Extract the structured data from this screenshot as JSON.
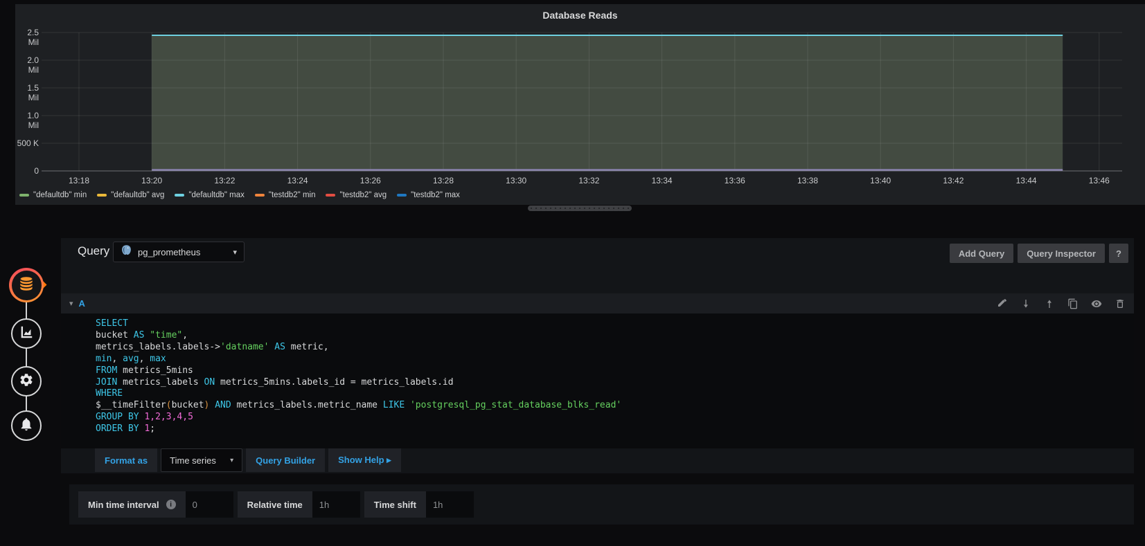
{
  "chart_panel": {
    "title": "Database Reads",
    "chart_data": {
      "type": "area",
      "title": "Database Reads",
      "x_ticks": [
        "13:18",
        "13:20",
        "13:22",
        "13:24",
        "13:26",
        "13:28",
        "13:30",
        "13:32",
        "13:34",
        "13:36",
        "13:38",
        "13:40",
        "13:42",
        "13:44",
        "13:46"
      ],
      "y_ticks": [
        "0",
        "500 K",
        "1.0 Mil",
        "1.5 Mil",
        "2.0 Mil",
        "2.5 Mil"
      ],
      "ylim": [
        0,
        2500000
      ],
      "grid": true,
      "legend_position": "bottom",
      "series": [
        {
          "name": "\"defaultdb\" min",
          "color": "#7EB26D",
          "value": 0
        },
        {
          "name": "\"defaultdb\" avg",
          "color": "#EAB839",
          "value": 0
        },
        {
          "name": "\"defaultdb\" max",
          "color": "#6ED0E0",
          "value": 2450000
        },
        {
          "name": "\"testdb2\" min",
          "color": "#EF843C",
          "value": 0
        },
        {
          "name": "\"testdb2\" avg",
          "color": "#E24D42",
          "value": 0
        },
        {
          "name": "\"testdb2\" max",
          "color": "#1F78C1",
          "value": 0
        }
      ],
      "data_window": {
        "start": "13:20",
        "end": "13:45"
      },
      "fill_color": "#434b41",
      "top_line_color": "#6ED0E0",
      "bottom_line_color": "#8a82ae"
    }
  },
  "query_header": {
    "title": "Query",
    "datasource": "pg_prometheus",
    "add_query_label": "Add Query",
    "query_inspector_label": "Query Inspector",
    "help_label": "?"
  },
  "query_row": {
    "ref_id": "A"
  },
  "sql_lines": [
    [
      {
        "c": "kw",
        "v": "SELECT"
      }
    ],
    [
      {
        "c": "pl",
        "v": "  bucket "
      },
      {
        "c": "kw",
        "v": "AS"
      },
      {
        "c": "pl",
        "v": " "
      },
      {
        "c": "str",
        "v": "\"time\""
      },
      {
        "c": "pl",
        "v": ","
      }
    ],
    [
      {
        "c": "pl",
        "v": "  metrics_labels.labels->"
      },
      {
        "c": "str",
        "v": "'datname'"
      },
      {
        "c": "pl",
        "v": " "
      },
      {
        "c": "kw",
        "v": "AS"
      },
      {
        "c": "pl",
        "v": " metric,"
      }
    ],
    [
      {
        "c": "pl",
        "v": "  "
      },
      {
        "c": "kw",
        "v": "min"
      },
      {
        "c": "pl",
        "v": ", "
      },
      {
        "c": "kw",
        "v": "avg"
      },
      {
        "c": "pl",
        "v": ", "
      },
      {
        "c": "kw",
        "v": "max"
      }
    ],
    [
      {
        "c": "kw",
        "v": "FROM"
      },
      {
        "c": "pl",
        "v": " metrics_5mins"
      }
    ],
    [
      {
        "c": "kw",
        "v": "JOIN"
      },
      {
        "c": "pl",
        "v": " metrics_labels "
      },
      {
        "c": "kw",
        "v": "ON"
      },
      {
        "c": "pl",
        "v": " metrics_5mins.labels_id = metrics_labels.id"
      }
    ],
    [
      {
        "c": "kw",
        "v": "WHERE"
      }
    ],
    [
      {
        "c": "pl",
        "v": "  $__timeFilter"
      },
      {
        "c": "par",
        "v": "("
      },
      {
        "c": "pl",
        "v": "bucket"
      },
      {
        "c": "par",
        "v": ")"
      },
      {
        "c": "pl",
        "v": " "
      },
      {
        "c": "kw",
        "v": "AND"
      },
      {
        "c": "pl",
        "v": " metrics_labels.metric_name "
      },
      {
        "c": "kw",
        "v": "LIKE"
      },
      {
        "c": "pl",
        "v": " "
      },
      {
        "c": "str",
        "v": "'postgresql_pg_stat_database_blks_read'"
      }
    ],
    [
      {
        "c": "kw",
        "v": "GROUP BY"
      },
      {
        "c": "pl",
        "v": " "
      },
      {
        "c": "num",
        "v": "1,2,3,4,5"
      }
    ],
    [
      {
        "c": "kw",
        "v": "ORDER BY"
      },
      {
        "c": "pl",
        "v": " "
      },
      {
        "c": "num",
        "v": "1"
      },
      {
        "c": "pl",
        "v": ";"
      }
    ]
  ],
  "format_bar": {
    "format_as_label": "Format as",
    "format_value": "Time series",
    "query_builder_label": "Query Builder",
    "show_help_label": "Show Help ▸"
  },
  "options": {
    "min_time_interval_label": "Min time interval",
    "min_time_interval_value": "0",
    "relative_time_label": "Relative time",
    "relative_time_value": "1h",
    "time_shift_label": "Time shift",
    "time_shift_value": "1h"
  },
  "icons": {
    "caret_down": "▾",
    "chevron_down": "▾",
    "info": "i"
  },
  "sidebar_tabs": [
    "queries",
    "visualization",
    "general",
    "alert"
  ]
}
